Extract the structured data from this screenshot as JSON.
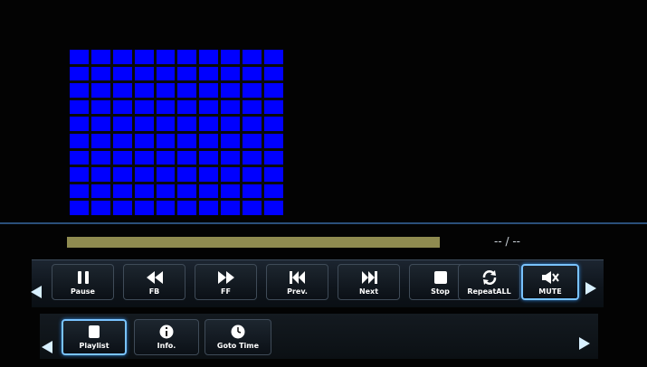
{
  "player": {
    "time_display": "-- / --",
    "progress_fraction": 1.0
  },
  "controls": [
    {
      "label": "Pause",
      "icon": "pause-icon"
    },
    {
      "label": "FB",
      "icon": "fast-backward-icon"
    },
    {
      "label": "FF",
      "icon": "fast-forward-icon"
    },
    {
      "label": "Prev.",
      "icon": "previous-icon"
    },
    {
      "label": "Next",
      "icon": "next-icon"
    },
    {
      "label": "Stop",
      "icon": "stop-icon"
    },
    {
      "label": "RepeatALL",
      "icon": "repeat-icon"
    },
    {
      "label": "MUTE",
      "icon": "mute-icon"
    }
  ],
  "menu": [
    {
      "label": "Playlist",
      "icon": "playlist-icon"
    },
    {
      "label": "Info.",
      "icon": "info-icon"
    },
    {
      "label": "Goto Time",
      "icon": "clock-icon"
    }
  ],
  "colors": {
    "grid_blue": "#0000ff",
    "progress": "#8f8b50",
    "highlight": "#79c3ff"
  }
}
